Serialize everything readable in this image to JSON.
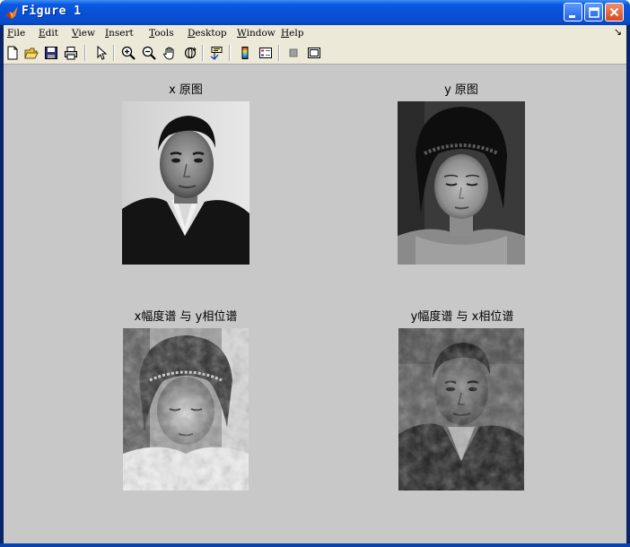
{
  "window": {
    "title": "Figure 1"
  },
  "menu": {
    "items": [
      {
        "accel": "F",
        "rest": "ile"
      },
      {
        "accel": "E",
        "rest": "dit"
      },
      {
        "accel": "V",
        "rest": "iew"
      },
      {
        "accel": "I",
        "rest": "nsert"
      },
      {
        "accel": "T",
        "rest": "ools"
      },
      {
        "accel": "D",
        "rest": "esktop"
      },
      {
        "accel": "W",
        "rest": "indow"
      },
      {
        "accel": "H",
        "rest": "elp"
      }
    ],
    "overflow_arrow": "↘"
  },
  "toolbar": {
    "icons": [
      "new-file-icon",
      "open-folder-icon",
      "save-icon",
      "print-icon",
      "pointer-icon",
      "zoom-in-icon",
      "zoom-out-icon",
      "pan-hand-icon",
      "rotate-3d-icon",
      "data-cursor-icon",
      "colorbar-icon",
      "legend-icon",
      "hide-plot-tools-icon",
      "show-plot-tools-icon"
    ]
  },
  "figure": {
    "background": "#c8c8c8",
    "subplots": [
      {
        "title": "x 原图",
        "image": "grayscale portrait photo of a man in a dark suit"
      },
      {
        "title": "y 原图",
        "image": "grayscale portrait photo of a woman with braided hair"
      },
      {
        "title": "x幅度谱 与 y相位谱",
        "image": "reconstructed image resembling the woman (y)"
      },
      {
        "title": "y幅度谱 与 x相位谱",
        "image": "reconstructed image resembling the man (x)"
      }
    ]
  },
  "colors": {
    "titlebar": "#0a5ae0",
    "chrome": "#ece9d8",
    "close_button": "#d8481e"
  }
}
